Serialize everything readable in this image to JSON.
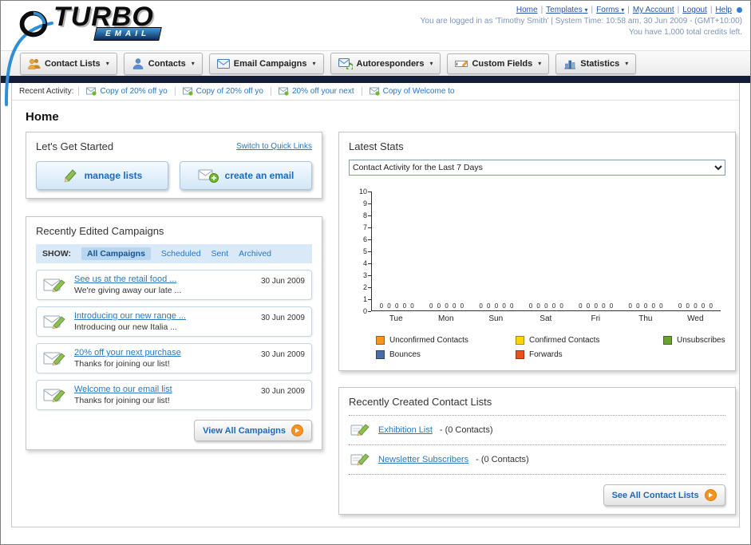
{
  "page_title": "Home",
  "icons": {
    "dropdown_arrow": "▾",
    "link_separator": "|"
  },
  "header": {
    "logo": {
      "title": "TURBO",
      "subtitle": "EMAIL"
    },
    "links": [
      {
        "label": "Home"
      },
      {
        "label": "Templates",
        "dropdown": true
      },
      {
        "label": "Forms",
        "dropdown": true
      },
      {
        "label": "My Account"
      },
      {
        "label": "Logout"
      },
      {
        "label": "Help"
      }
    ],
    "login_info": "You are logged in as 'Timothy Smith' | System Time: 10:58 am, 30 Jun 2009 - (GMT+10:00)",
    "credits_info": "You have 1,000 total credits left."
  },
  "main_nav": {
    "items": [
      {
        "label": "Contact Lists"
      },
      {
        "label": "Contacts"
      },
      {
        "label": "Email Campaigns"
      },
      {
        "label": "Autoresponders"
      },
      {
        "label": "Custom Fields"
      },
      {
        "label": "Statistics"
      }
    ]
  },
  "recent_activity": {
    "label": "Recent Activity:",
    "items": [
      {
        "label": "Copy of 20% off yo"
      },
      {
        "label": "Copy of 20% off yo"
      },
      {
        "label": "20% off your next"
      },
      {
        "label": "Copy of Welcome to"
      }
    ]
  },
  "get_started": {
    "title": "Let's Get Started",
    "switch_link": "Switch to Quick Links",
    "manage_lists_label": "manage lists",
    "create_email_label": "create an email"
  },
  "campaigns": {
    "title": "Recently Edited Campaigns",
    "show_label": "SHOW:",
    "tabs": [
      {
        "label": "All Campaigns",
        "active": true
      },
      {
        "label": "Scheduled"
      },
      {
        "label": "Sent"
      },
      {
        "label": "Archived"
      }
    ],
    "rows": [
      {
        "title": "See us at the retail food ...",
        "subtitle": "We're giving away our late ...",
        "date": "30 Jun 2009"
      },
      {
        "title": "Introducing our new range ...",
        "subtitle": "Introducing our new Italia ...",
        "date": "30 Jun 2009"
      },
      {
        "title": "20% off your next purchase",
        "subtitle": "Thanks for joining our list!",
        "date": "30 Jun 2009"
      },
      {
        "title": "Welcome to our email list",
        "subtitle": "Thanks for joining our list!",
        "date": "30 Jun 2009"
      }
    ],
    "view_all_label": "View All Campaigns"
  },
  "latest_stats": {
    "title": "Latest Stats",
    "period_selected": "Contact Activity for the Last 7 Days",
    "chart_data": {
      "type": "bar",
      "title": "Contact Activity for the Last 7 Days",
      "categories": [
        "Tue",
        "Mon",
        "Sun",
        "Sat",
        "Fri",
        "Thu",
        "Wed"
      ],
      "series": [
        {
          "name": "Unconfirmed Contacts",
          "color": "#f7941d",
          "values": [
            0,
            0,
            0,
            0,
            0,
            0,
            0
          ]
        },
        {
          "name": "Confirmed Contacts",
          "color": "#ffd400",
          "values": [
            0,
            0,
            0,
            0,
            0,
            0,
            0
          ]
        },
        {
          "name": "Unsubscribes",
          "color": "#69a22f",
          "values": [
            0,
            0,
            0,
            0,
            0,
            0,
            0
          ]
        },
        {
          "name": "Bounces",
          "color": "#4a6da7",
          "values": [
            0,
            0,
            0,
            0,
            0,
            0,
            0
          ]
        },
        {
          "name": "Forwards",
          "color": "#e8501e",
          "values": [
            0,
            0,
            0,
            0,
            0,
            0,
            0
          ]
        }
      ],
      "ylim": [
        0,
        10
      ],
      "y_tick_step": 1,
      "grid": false,
      "legend_position": "bottom",
      "value_labels_shown": true
    }
  },
  "contact_lists": {
    "title": "Recently Created Contact Lists",
    "items": [
      {
        "name": "Exhibition List",
        "detail": "- (0 Contacts)"
      },
      {
        "name": "Newsletter Subscribers",
        "detail": "- (0 Contacts)"
      }
    ],
    "see_all_label": "See All Contact Lists"
  }
}
